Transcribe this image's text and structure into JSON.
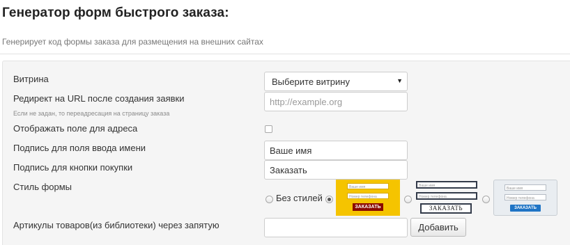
{
  "header": {
    "title": "Генератор форм быстрого заказа:",
    "subtitle": "Генерирует код формы заказа для размещения на внешних сайтах"
  },
  "form": {
    "storefront": {
      "label": "Витрина",
      "selected": "Выберите витрину"
    },
    "redirect": {
      "label": "Редирект на URL после создания заявки",
      "hint": "Если не задан, то переадресация на страницу заказа",
      "placeholder": "http://example.org",
      "value": ""
    },
    "show_address": {
      "label": "Отображать поле для адреса",
      "checked": false
    },
    "name_caption": {
      "label": "Подпись для поля ввода имени",
      "value": "Ваше имя"
    },
    "buy_caption": {
      "label": "Подпись для кнопки покупки",
      "value": "Заказать"
    },
    "style": {
      "label": "Стиль формы",
      "no_style_label": "Без стилей",
      "selected_index": 1,
      "previews": [
        {
          "name_placeholder": "Ваше имя",
          "phone_placeholder": "Номер телефона",
          "button": "ЗАКАЗАТЬ",
          "accent": "#f5c400",
          "button_color": "#8b0a00"
        },
        {
          "name_placeholder": "Ваше имя",
          "phone_placeholder": "Номер телефона",
          "button": "ЗАКАЗАТЬ",
          "accent": "#ffffff",
          "button_color": "#333b4a"
        },
        {
          "name_placeholder": "Ваше имя",
          "phone_placeholder": "Номер телефона",
          "button": "ЗАКАЗАТЬ",
          "accent": "#e9edf1",
          "button_color": "#1f74c5"
        }
      ]
    },
    "articles": {
      "label": "Артикулы товаров(из библиотеки) через запятую",
      "value": "",
      "add_button": "Добавить"
    }
  }
}
